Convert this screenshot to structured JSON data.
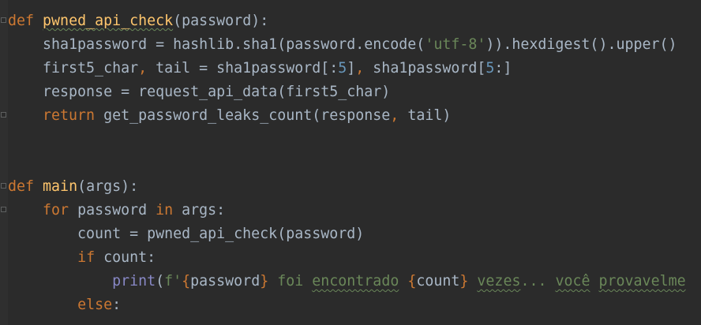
{
  "editor": {
    "lines": [
      [
        {
          "t": "def",
          "c": "tok-keyword"
        },
        {
          "t": " ",
          "c": "tok-ident"
        },
        {
          "t": "pwned_api_check",
          "c": "tok-fn-def"
        },
        {
          "t": "(password):",
          "c": "tok-ident"
        }
      ],
      [
        {
          "t": "    sha1password = hashlib.sha1(password.encode(",
          "c": "tok-ident"
        },
        {
          "t": "'utf-8'",
          "c": "tok-string"
        },
        {
          "t": ")).hexdigest().upper()",
          "c": "tok-ident"
        }
      ],
      [
        {
          "t": "    first5_char",
          "c": "tok-ident"
        },
        {
          "t": ",",
          "c": "tok-punct"
        },
        {
          "t": " tail = sha1password[:",
          "c": "tok-ident"
        },
        {
          "t": "5",
          "c": "tok-number"
        },
        {
          "t": "]",
          "c": "tok-ident"
        },
        {
          "t": ",",
          "c": "tok-punct"
        },
        {
          "t": " sha1password[",
          "c": "tok-ident"
        },
        {
          "t": "5",
          "c": "tok-number"
        },
        {
          "t": ":]",
          "c": "tok-ident"
        }
      ],
      [
        {
          "t": "    response = request_api_data(first5_char)",
          "c": "tok-ident"
        }
      ],
      [
        {
          "t": "    ",
          "c": "tok-ident"
        },
        {
          "t": "return",
          "c": "tok-keyword"
        },
        {
          "t": " get_password_leaks_count(response",
          "c": "tok-ident"
        },
        {
          "t": ",",
          "c": "tok-punct"
        },
        {
          "t": " tail)",
          "c": "tok-ident"
        }
      ],
      [],
      [],
      [
        {
          "t": "def",
          "c": "tok-keyword"
        },
        {
          "t": " ",
          "c": "tok-ident"
        },
        {
          "t": "main",
          "c": "tok-fn-def-plain"
        },
        {
          "t": "(args):",
          "c": "tok-ident"
        }
      ],
      [
        {
          "t": "    ",
          "c": "tok-ident"
        },
        {
          "t": "for",
          "c": "tok-keyword"
        },
        {
          "t": " password ",
          "c": "tok-ident"
        },
        {
          "t": "in",
          "c": "tok-keyword"
        },
        {
          "t": " args:",
          "c": "tok-ident"
        }
      ],
      [
        {
          "t": "        count = pwned_api_check(password)",
          "c": "tok-ident"
        }
      ],
      [
        {
          "t": "        ",
          "c": "tok-ident"
        },
        {
          "t": "if",
          "c": "tok-keyword"
        },
        {
          "t": " count:",
          "c": "tok-ident"
        }
      ],
      [
        {
          "t": "            ",
          "c": "tok-ident"
        },
        {
          "t": "print",
          "c": "tok-builtin"
        },
        {
          "t": "(",
          "c": "tok-ident"
        },
        {
          "t": "f'",
          "c": "tok-fstring"
        },
        {
          "t": "{",
          "c": "tok-brace"
        },
        {
          "t": "password",
          "c": "tok-ident"
        },
        {
          "t": "}",
          "c": "tok-brace"
        },
        {
          "t": " foi ",
          "c": "tok-fstring"
        },
        {
          "t": "encontrado",
          "c": "tok-fstring typo"
        },
        {
          "t": " ",
          "c": "tok-fstring"
        },
        {
          "t": "{",
          "c": "tok-brace"
        },
        {
          "t": "count",
          "c": "tok-ident"
        },
        {
          "t": "}",
          "c": "tok-brace"
        },
        {
          "t": " ",
          "c": "tok-fstring"
        },
        {
          "t": "vezes",
          "c": "tok-fstring typo"
        },
        {
          "t": "... ",
          "c": "tok-fstring"
        },
        {
          "t": "você",
          "c": "tok-fstring typo"
        },
        {
          "t": " ",
          "c": "tok-fstring"
        },
        {
          "t": "provavelme",
          "c": "tok-fstring typo"
        }
      ],
      [
        {
          "t": "        ",
          "c": "tok-ident"
        },
        {
          "t": "else",
          "c": "tok-keyword"
        },
        {
          "t": ":",
          "c": "tok-ident"
        }
      ]
    ],
    "colors": {
      "background": "#2b2b2b",
      "keyword": "#cc7832",
      "function_name": "#ffc66d",
      "string": "#6a8759",
      "number": "#6897bb",
      "builtin": "#8888c6",
      "default_text": "#a9b7c6"
    }
  }
}
